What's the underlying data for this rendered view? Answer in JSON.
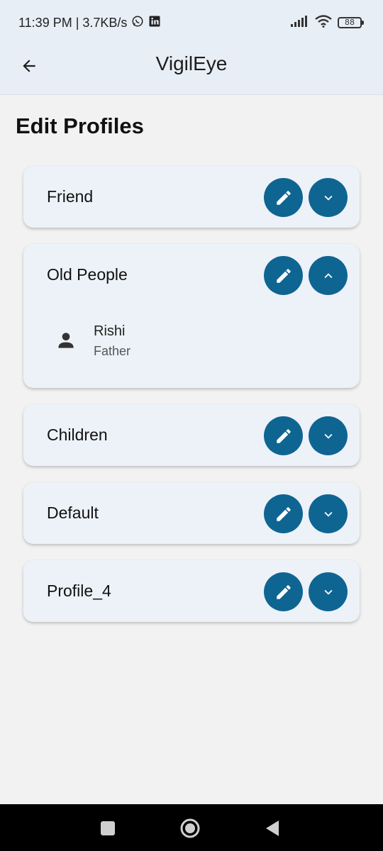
{
  "status_bar": {
    "time_speed": "11:39 PM | 3.7KB/s",
    "battery": "88",
    "icons": [
      "whatsapp-icon",
      "linkedin-icon",
      "signal-icon",
      "wifi-icon",
      "battery-icon"
    ]
  },
  "app_bar": {
    "title": "VigilEye",
    "back_icon": "arrow-left-icon"
  },
  "page": {
    "title": "Edit Profiles"
  },
  "profiles": [
    {
      "name": "Friend",
      "expanded": false
    },
    {
      "name": "Old People",
      "expanded": true,
      "members": [
        {
          "name": "Rishi",
          "relation": "Father"
        }
      ]
    },
    {
      "name": "Children",
      "expanded": false
    },
    {
      "name": "Default",
      "expanded": false
    },
    {
      "name": "Profile_4",
      "expanded": false
    }
  ],
  "colors": {
    "accent": "#0f6592",
    "card_bg": "#edf2f8",
    "topbar_bg": "#e7eef6",
    "page_bg": "#f2f2f2"
  },
  "nav_bar": {
    "icons": [
      "recents-square-icon",
      "home-circle-icon",
      "back-triangle-icon"
    ]
  }
}
